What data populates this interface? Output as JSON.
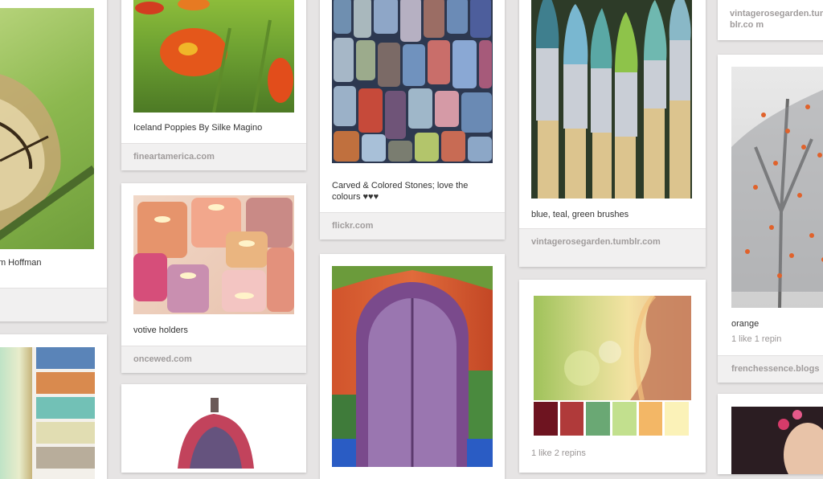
{
  "pins": {
    "butterfly": {
      "caption": "Jim Hoffman"
    },
    "poppies": {
      "caption": "Iceland Poppies By Silke Magino",
      "source": "fineartamerica.com"
    },
    "stones": {
      "caption": "Carved & Colored Stones; love the colours ♥♥♥",
      "source": "flickr.com"
    },
    "brushes": {
      "caption": "blue, teal, green brushes",
      "source": "vintagerosegarden.tumblr.com"
    },
    "top_right": {
      "source": "vintagerosegarden.tumblr.co m"
    },
    "candles": {
      "caption": "votive holders",
      "source": "oncewed.com"
    },
    "door": {},
    "tree": {
      "caption": "orange",
      "stats": "1 like  1 repin",
      "source": "frenchessence.blogs"
    },
    "palette_photo": {
      "stats": "1 like  2 repins",
      "swatches": [
        "#6e1420",
        "#b03a3a",
        "#6aa874",
        "#c2e08e",
        "#f3b766",
        "#fbf2b8"
      ]
    },
    "swatch_pin": {
      "swatches": [
        "#5a84b8",
        "#d98a4e",
        "#72c1b6",
        "#e1ddb2",
        "#b8ad9b"
      ]
    },
    "scarf": {},
    "portrait": {}
  }
}
